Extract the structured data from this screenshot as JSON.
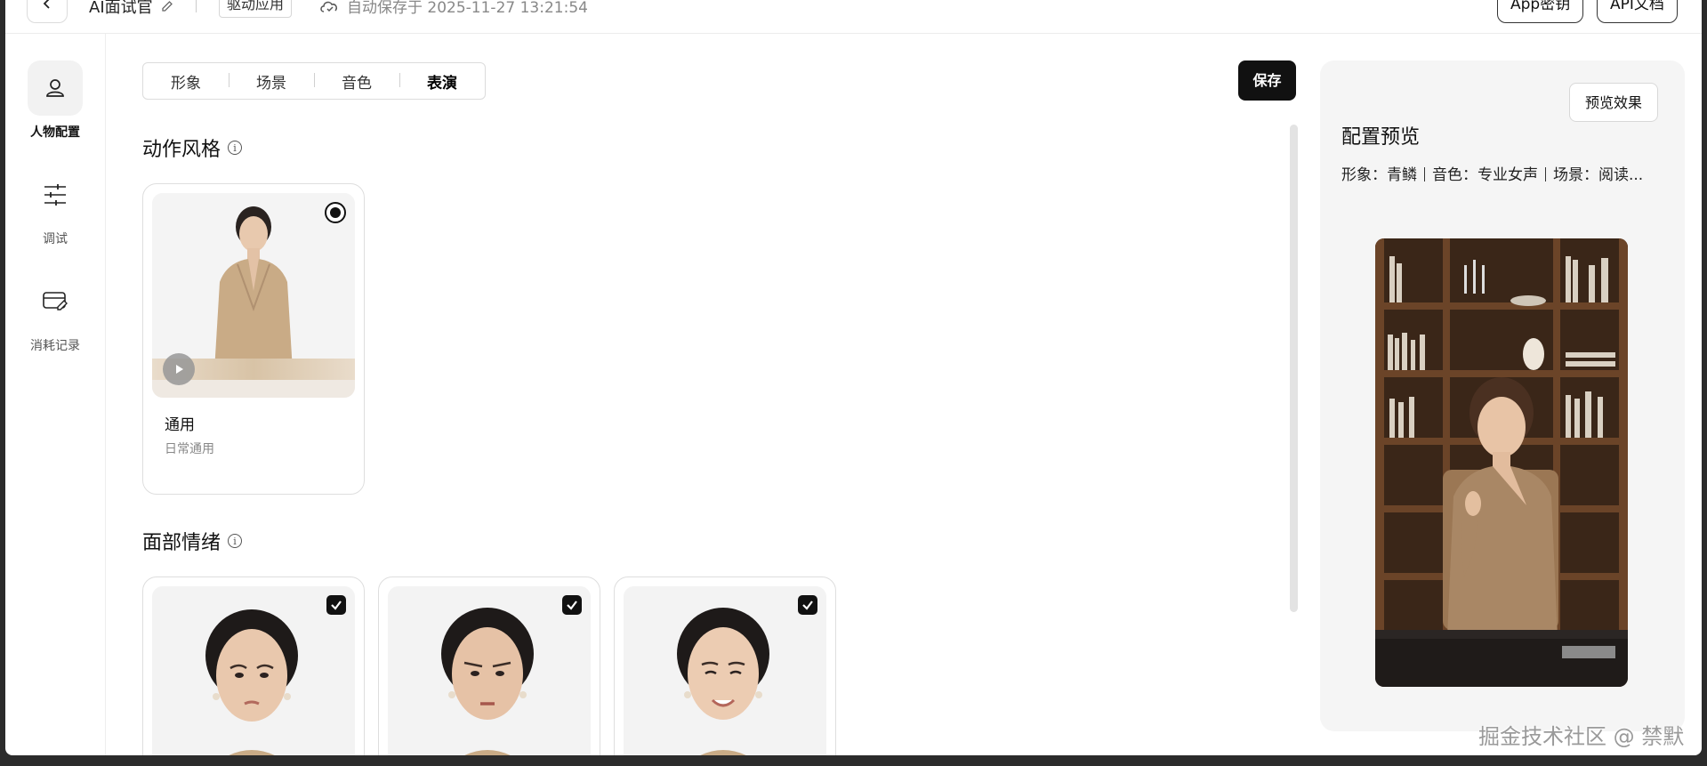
{
  "topbar": {
    "app_name": "AI面试官",
    "app_type": "驱动应用",
    "autosave_text": "自动保存于 2025-11-27 13:21:54",
    "api_key_label": "App密钥",
    "api_doc_label": "API文档"
  },
  "sidebar": {
    "items": [
      {
        "label": "人物配置",
        "icon": "person-icon",
        "active": true
      },
      {
        "label": "调试",
        "icon": "sliders-icon",
        "active": false
      },
      {
        "label": "消耗记录",
        "icon": "card-edit-icon",
        "active": false
      }
    ]
  },
  "tabs": [
    {
      "label": "形象",
      "active": false
    },
    {
      "label": "场景",
      "active": false
    },
    {
      "label": "音色",
      "active": false
    },
    {
      "label": "表演",
      "active": true
    }
  ],
  "save_label": "保存",
  "motion_section": {
    "title": "动作风格",
    "cards": [
      {
        "title": "通用",
        "subtitle": "日常通用",
        "selected": true
      }
    ]
  },
  "emotion_section": {
    "title": "面部情绪",
    "cards": [
      {
        "selected": true
      },
      {
        "selected": true
      },
      {
        "selected": true
      }
    ]
  },
  "preview": {
    "button_label": "预览效果",
    "title": "配置预览",
    "meta": {
      "avatar": "形象：青鳞",
      "voice": "音色：专业女声",
      "scene": "场景：阅读..."
    }
  },
  "watermark": "掘金技术社区 @ 禁默",
  "colors": {
    "accent": "#111111",
    "panel_bg": "#f5f5f5",
    "border": "#dedede"
  }
}
